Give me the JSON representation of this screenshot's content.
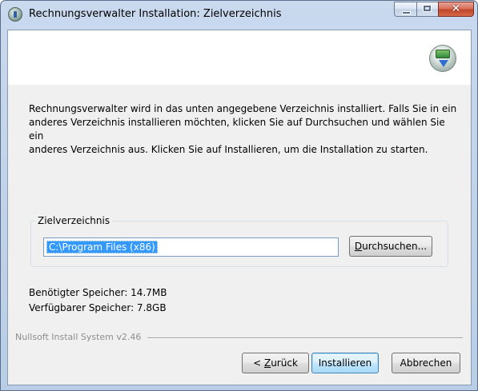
{
  "window": {
    "title": "Rechnungsverwalter Installation: Zielverzeichnis",
    "close_glyph": "✕"
  },
  "description": "Rechnungsverwalter wird in das unten angegebene Verzeichnis installiert. Falls Sie in ein\nanderes Verzeichnis installieren möchten, klicken Sie auf Durchsuchen und wählen Sie ein\nanderes Verzeichnis aus. Klicken Sie auf Installieren, um die Installation zu starten.",
  "target_group": {
    "label": "Zielverzeichnis",
    "path_value": "C:\\Program Files (x86)",
    "browse_label_mnemonic": "D",
    "browse_label_rest": "urchsuchen..."
  },
  "space": {
    "required": "Benötigter Speicher: 14.7MB",
    "available": "Verfügbarer Speicher: 7.8GB"
  },
  "branding": "Nullsoft Install System v2.46",
  "buttons": {
    "back_prefix": "< ",
    "back_mnemonic": "Z",
    "back_rest": "urück",
    "install_label": "Installieren",
    "cancel_label": "Abbrechen"
  }
}
